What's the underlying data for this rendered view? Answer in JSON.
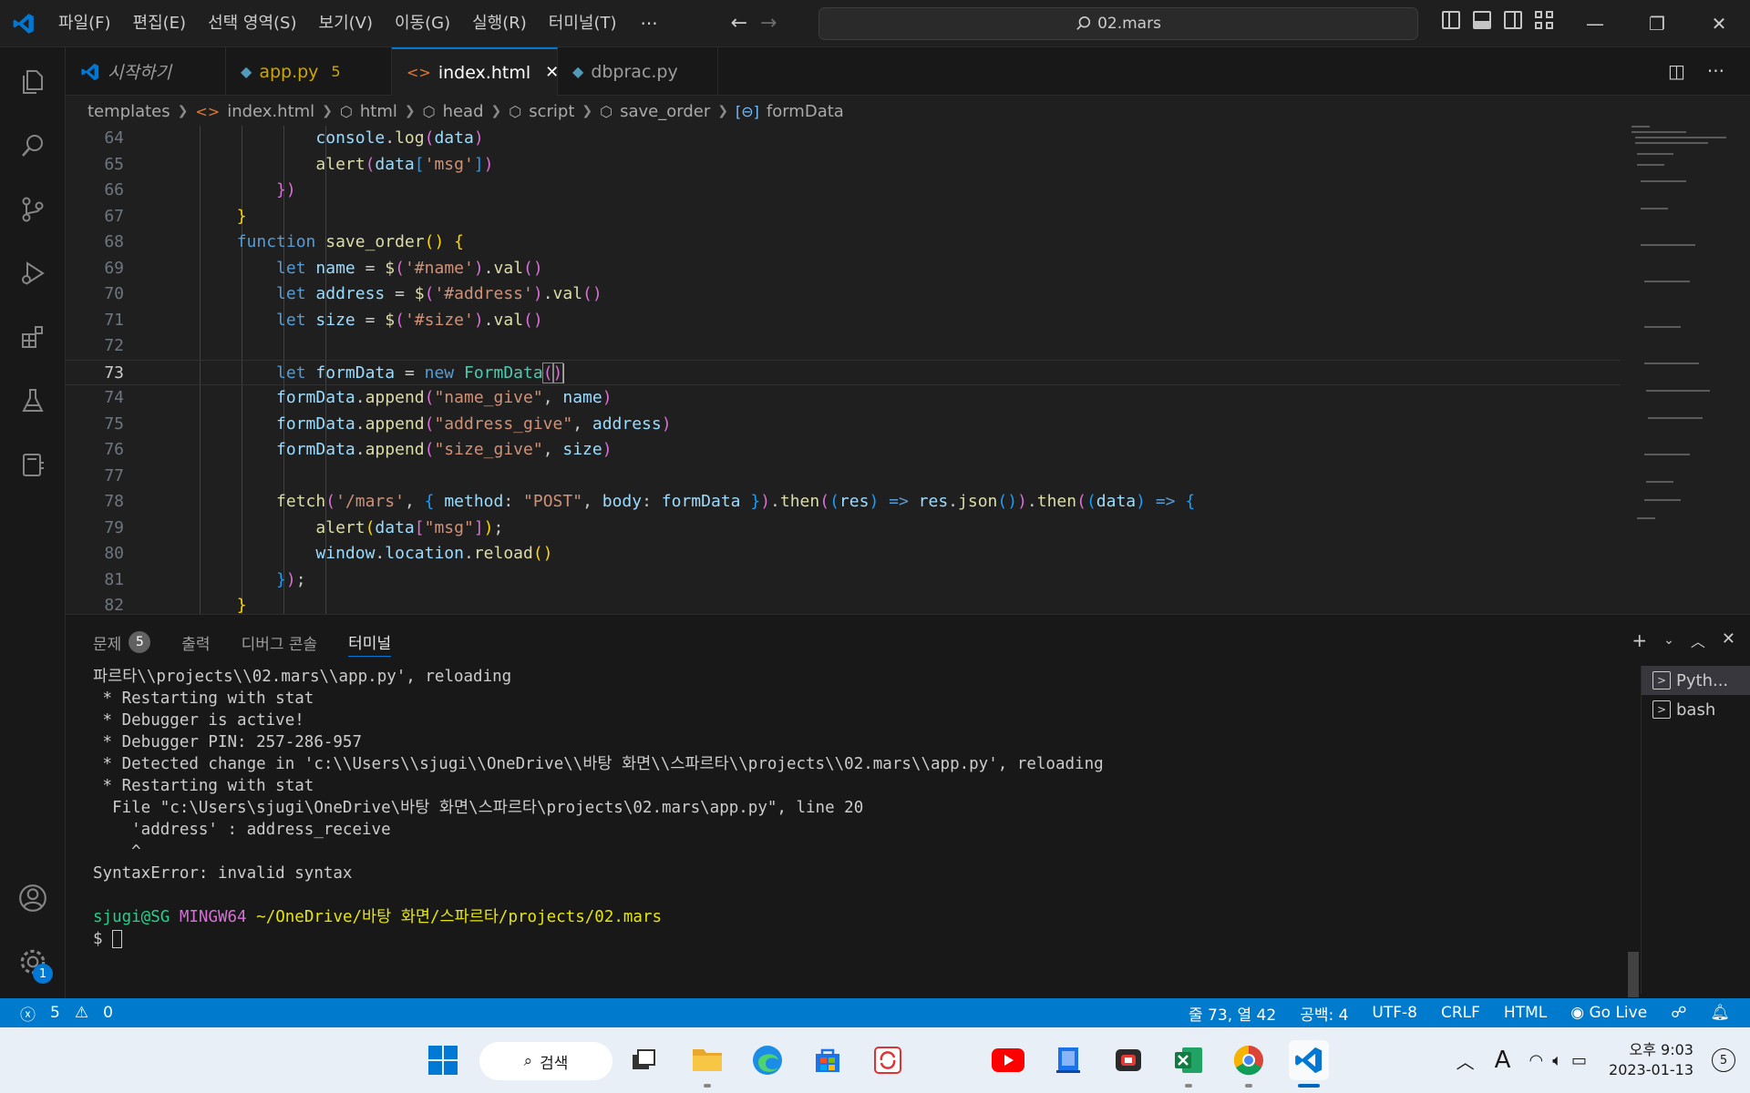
{
  "menu": [
    "파일(F)",
    "편집(E)",
    "선택 영역(S)",
    "보기(V)",
    "이동(G)",
    "실행(R)",
    "터미널(T)"
  ],
  "search": {
    "text": "02.mars"
  },
  "tabs": [
    {
      "label": "시작하기",
      "icon": "vscode-icon"
    },
    {
      "label": "app.py",
      "icon": "python-icon",
      "count": "5"
    },
    {
      "label": "index.html",
      "icon": "html-icon"
    },
    {
      "label": "dbprac.py",
      "icon": "python-icon"
    }
  ],
  "breadcrumb": [
    "templates",
    "index.html",
    "html",
    "head",
    "script",
    "save_order",
    "formData"
  ],
  "editor": {
    "line_numbers": [
      "64",
      "65",
      "66",
      "67",
      "68",
      "69",
      "70",
      "71",
      "72",
      "73",
      "74",
      "75",
      "76",
      "77",
      "78",
      "79",
      "80",
      "81",
      "82"
    ],
    "current_line": "73"
  },
  "panel": {
    "tabs": {
      "problems": "문제",
      "problems_count": "5",
      "output": "출력",
      "debug": "디버그 콘솔",
      "terminal": "터미널"
    },
    "terminal_lines": [
      "파르타\\\\projects\\\\02.mars\\\\app.py', reloading",
      " * Restarting with stat",
      " * Debugger is active!",
      " * Debugger PIN: 257-286-957",
      " * Detected change in 'c:\\\\Users\\\\sjugi\\\\OneDrive\\\\바탕 화면\\\\스파르타\\\\projects\\\\02.mars\\\\app.py', reloading",
      " * Restarting with stat",
      "  File \"c:\\Users\\sjugi\\OneDrive\\바탕 화면\\스파르타\\projects\\02.mars\\app.py\", line 20",
      "    'address' : address_receive",
      "    ^",
      "SyntaxError: invalid syntax",
      ""
    ],
    "prompt": {
      "user": "sjugi@SG",
      "env": "MINGW64",
      "path": "~/OneDrive/바탕 화면/스파르타/projects/02.mars",
      "symbol": "$"
    },
    "terminals": [
      "Pyth...",
      "bash"
    ]
  },
  "statusbar": {
    "errors": "5",
    "warnings": "0",
    "position": "줄 73, 열 42",
    "spaces": "공백: 4",
    "encoding": "UTF-8",
    "eol": "CRLF",
    "language": "HTML",
    "golive": "Go Live"
  },
  "taskbar": {
    "search": "검색",
    "time": "오후 9:03",
    "date": "2023-01-13",
    "notifications": "5"
  },
  "activity_badge": "1",
  "colors": {
    "accent": "#007acc",
    "keyword": "#569cd6",
    "string": "#ce9178",
    "function": "#dcdcaa",
    "variable": "#9cdcfe",
    "class": "#4ec9b0"
  }
}
